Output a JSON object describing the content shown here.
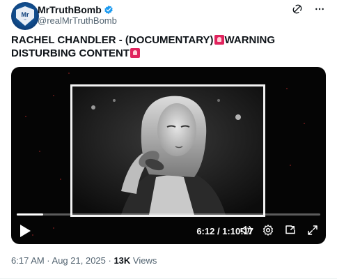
{
  "author": {
    "display_name": "MrTruthBomb",
    "handle": "@realMrTruthBomb",
    "avatar_text": "Mr",
    "verified": true
  },
  "post": {
    "text_part1": "RACHEL CHANDLER - (DOCUMENTARY)",
    "emoji": "rotating-light",
    "text_part2": "WARNING DISTURBING CONTENT"
  },
  "video": {
    "time_display": "6:12 / 1:10:17",
    "progress_fraction": 0.088
  },
  "meta": {
    "timestamp": "6:17 AM · Aug 21, 2025 · ",
    "views_count": "13K",
    "views_label": "Views"
  },
  "colors": {
    "accent": "#1d9bf0",
    "text_primary": "#0f1419",
    "text_secondary": "#536471",
    "emoji_red": "#e0245e"
  },
  "icons": {
    "verified": "verified-badge-icon",
    "grok": "grok-icon",
    "more": "more-icon",
    "play": "play-icon",
    "volume": "volume-icon",
    "settings": "settings-icon",
    "pip": "picture-in-picture-icon",
    "fullscreen": "fullscreen-icon"
  }
}
